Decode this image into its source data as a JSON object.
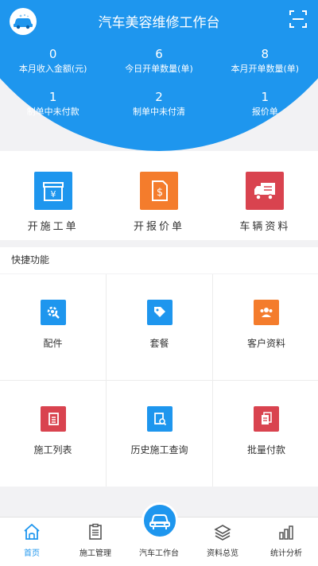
{
  "header": {
    "title": "汽车美容维修工作台",
    "logo_icon": "car-wash-logo-icon",
    "scan_icon": "scan-icon",
    "background": "#1e96ee"
  },
  "stats": [
    [
      {
        "value": "0",
        "label": "本月收入金额(元)"
      },
      {
        "value": "6",
        "label": "今日开单数量(单)"
      },
      {
        "value": "8",
        "label": "本月开单数量(单)"
      }
    ],
    [
      {
        "value": "1",
        "label": "制单中未付款"
      },
      {
        "value": "2",
        "label": "制单中未付清"
      },
      {
        "value": "1",
        "label": "报价单"
      }
    ]
  ],
  "main_actions": [
    {
      "label": "开施工单",
      "icon": "work-order-box-icon",
      "color": "#1e96ee"
    },
    {
      "label": "开报价单",
      "icon": "quote-dollar-icon",
      "color": "#f47c2c"
    },
    {
      "label": "车辆资料",
      "icon": "truck-icon",
      "color": "#d9434f"
    }
  ],
  "quick": {
    "title": "快捷功能",
    "items": [
      {
        "label": "配件",
        "icon": "gear-wrench-icon",
        "color": "#1e96ee"
      },
      {
        "label": "套餐",
        "icon": "tag-icon",
        "color": "#1e96ee"
      },
      {
        "label": "客户资料",
        "icon": "people-icon",
        "color": "#f47c2c"
      },
      {
        "label": "施工列表",
        "icon": "clipboard-list-icon",
        "color": "#d9434f"
      },
      {
        "label": "历史施工查询",
        "icon": "document-search-icon",
        "color": "#1e96ee"
      },
      {
        "label": "批量付款",
        "icon": "batch-payment-icon",
        "color": "#d9434f"
      }
    ]
  },
  "nav": {
    "active_color": "#1e96ee",
    "items": [
      {
        "label": "首页",
        "icon": "home-icon"
      },
      {
        "label": "施工管理",
        "icon": "clipboard-icon"
      },
      {
        "label": "汽车工作台",
        "icon": "car-workbench-icon"
      },
      {
        "label": "资料总览",
        "icon": "layers-icon"
      },
      {
        "label": "统计分析",
        "icon": "bar-chart-icon"
      }
    ]
  }
}
